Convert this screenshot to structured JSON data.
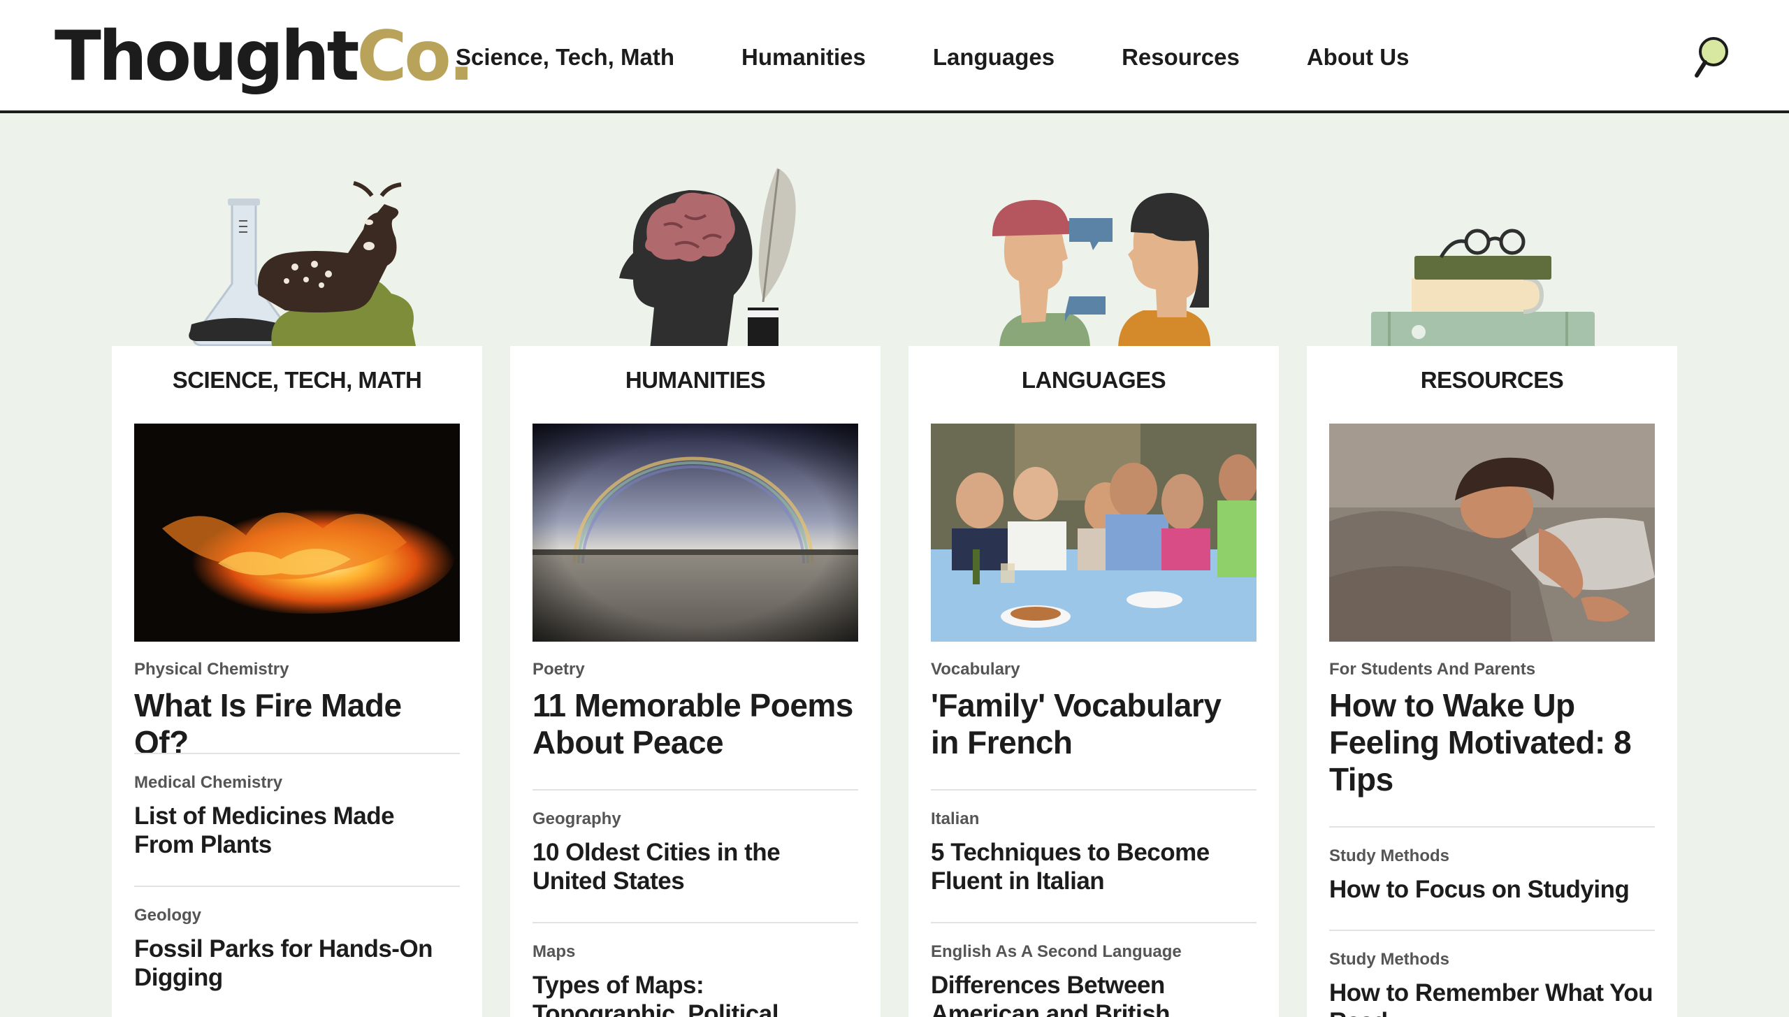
{
  "brand": {
    "logo_main": "Thought",
    "logo_accent": "Co.",
    "accent_color": "#b9a35a"
  },
  "nav": {
    "items": [
      {
        "label": "Science, Tech, Math"
      },
      {
        "label": "Humanities"
      },
      {
        "label": "Languages"
      },
      {
        "label": "Resources"
      },
      {
        "label": "About Us"
      }
    ],
    "search_icon": "magnifier-icon"
  },
  "categories": [
    {
      "title": "Science, Tech, Math",
      "illustration": "flask-and-deer",
      "image": "fire-photo",
      "articles": [
        {
          "tag": "Physical Chemistry",
          "headline": "What Is Fire Made Of?"
        },
        {
          "tag": "Medical Chemistry",
          "headline": "List of Medicines Made From Plants"
        },
        {
          "tag": "Geology",
          "headline": "Fossil Parks for Hands-On Digging"
        }
      ]
    },
    {
      "title": "Humanities",
      "illustration": "head-brain-quill",
      "image": "rainbow-beach-photo",
      "articles": [
        {
          "tag": "Poetry",
          "headline": "11 Memorable Poems About Peace"
        },
        {
          "tag": "Geography",
          "headline": "10 Oldest Cities in the United States"
        },
        {
          "tag": "Maps",
          "headline": "Types of Maps: Topographic, Political, Climate, and More"
        }
      ]
    },
    {
      "title": "Languages",
      "illustration": "two-people-speech-bubbles",
      "image": "family-dinner-photo",
      "articles": [
        {
          "tag": "Vocabulary",
          "headline": "'Family' Vocabulary in French"
        },
        {
          "tag": "Italian",
          "headline": "5 Techniques to Become Fluent in Italian"
        },
        {
          "tag": "English As A Second Language",
          "headline": "Differences Between American and British English"
        }
      ]
    },
    {
      "title": "Resources",
      "illustration": "books-and-glasses",
      "image": "woman-waking-photo",
      "articles": [
        {
          "tag": "For Students And Parents",
          "headline": "How to Wake Up Feeling Motivated: 8 Tips"
        },
        {
          "tag": "Study Methods",
          "headline": "How to Focus on Studying"
        },
        {
          "tag": "Study Methods",
          "headline": "How to Remember What You Read"
        }
      ]
    }
  ]
}
